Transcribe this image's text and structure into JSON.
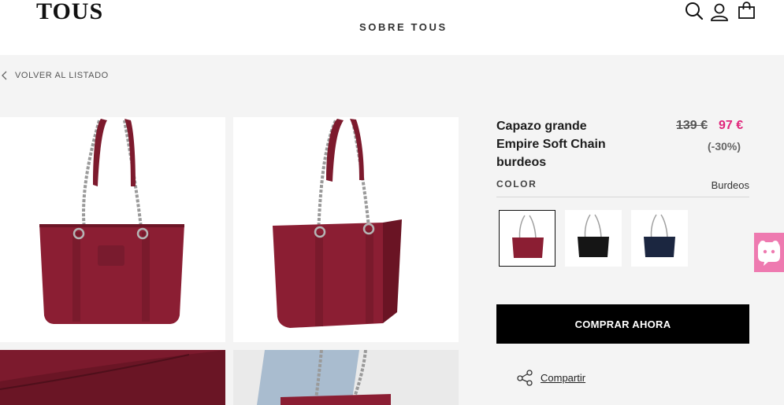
{
  "header": {
    "logo": "TOUS",
    "nav": [
      "SOBRE TOUS"
    ],
    "icons": [
      "search-icon",
      "user-icon",
      "bag-icon"
    ]
  },
  "back_link": "VOLVER AL LISTADO",
  "product": {
    "title": "Capazo grande Empire Soft Chain burdeos",
    "old_price": "139 €",
    "price": "97 €",
    "discount": "(-30%)",
    "color_label": "COLOR",
    "color_value": "Burdeos",
    "swatches": [
      {
        "color": "#8b1e33",
        "selected": true
      },
      {
        "color": "#151515",
        "selected": false
      },
      {
        "color": "#1b2640",
        "selected": false
      }
    ],
    "buy_label": "COMPRAR AHORA",
    "share_label": "Compartir"
  },
  "colors": {
    "accent_price": "#e0257b",
    "bag": "#8b1e33",
    "chat_bubble": "#ee7ab0"
  }
}
